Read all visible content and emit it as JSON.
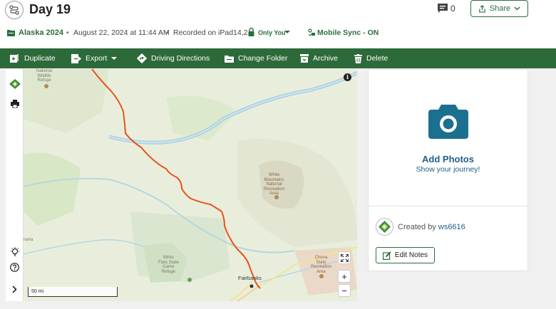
{
  "header": {
    "title": "Day 19",
    "comment_count": "0",
    "share_label": "Share"
  },
  "meta": {
    "folder": "Alaska 2024",
    "separator": "•",
    "date": "August 22, 2024 at 11:44 AM",
    "recorded": "Recorded on iPad14,2",
    "privacy": "Only You",
    "sync": "Mobile Sync - ON"
  },
  "toolbar": {
    "duplicate": "Duplicate",
    "export": "Export",
    "driving_directions": "Driving Directions",
    "change_folder": "Change Folder",
    "archive": "Archive",
    "delete": "Delete"
  },
  "map": {
    "labels": {
      "wildlife_refuge": "National\nWildlife\nRefuge",
      "white_mountains": "White\nMountains\nNational\nRecreation\nArea",
      "minto_flats": "Minto\nFlats State\nGame\nRefuge",
      "chena": "Chena\nState\nRecreation\nArea",
      "fairbanks": "Fairbanks",
      "nenana": "nana"
    },
    "scale": "50 mi",
    "zoom_in": "+",
    "zoom_out": "−",
    "info": "i"
  },
  "panel": {
    "add_photos": "Add Photos",
    "show_journey": "Show your journey!",
    "created_by": "Created by",
    "username": "ws6616",
    "edit_notes": "Edit Notes"
  },
  "colors": {
    "brand_green": "#2d6a3a",
    "link_blue": "#1f5f86",
    "track_orange": "#e8521c",
    "camera_teal": "#1b6f8f"
  }
}
